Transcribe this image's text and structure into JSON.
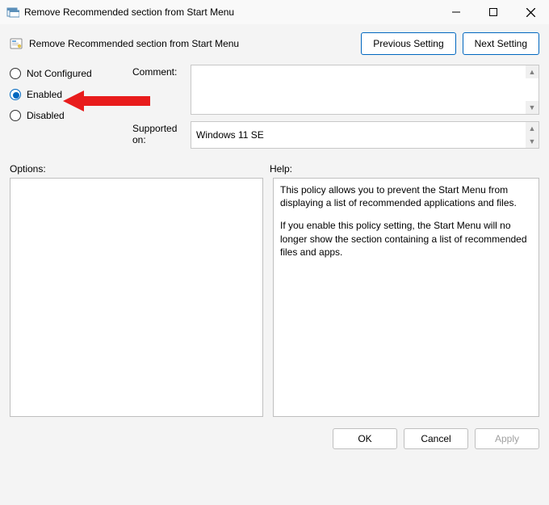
{
  "titlebar": {
    "title": "Remove Recommended section from Start Menu"
  },
  "header": {
    "title": "Remove Recommended section from Start Menu",
    "prev_label": "Previous Setting",
    "next_label": "Next Setting"
  },
  "radios": {
    "not_configured": "Not Configured",
    "enabled": "Enabled",
    "disabled": "Disabled",
    "selected": "enabled"
  },
  "fields": {
    "comment_label": "Comment:",
    "supported_label": "Supported on:",
    "supported_value": "Windows 11 SE"
  },
  "labels": {
    "options": "Options:",
    "help": "Help:"
  },
  "help": {
    "p1": "This policy allows you to prevent the Start Menu from displaying a list of recommended applications and files.",
    "p2": "If you enable this policy setting, the Start Menu will no longer show the section containing a list of recommended files and apps."
  },
  "footer": {
    "ok": "OK",
    "cancel": "Cancel",
    "apply": "Apply"
  }
}
